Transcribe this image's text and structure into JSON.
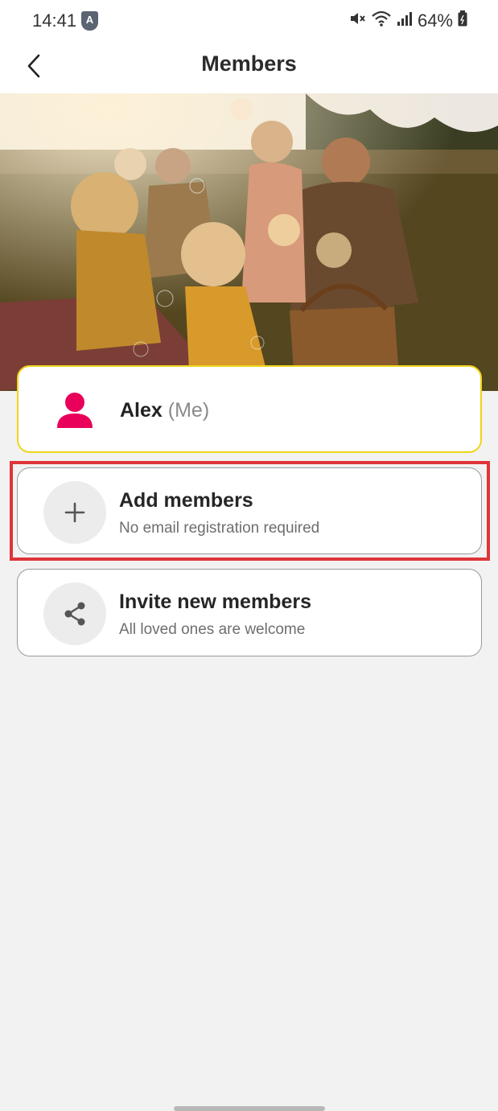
{
  "status_bar": {
    "time": "14:41",
    "badge_letter": "A",
    "battery": "64%"
  },
  "header": {
    "title": "Members"
  },
  "me_card": {
    "name": "Alex",
    "suffix": "(Me)",
    "accent_color": "#e8005a",
    "border_color": "#f0d51a"
  },
  "actions": [
    {
      "title": "Add members",
      "subtitle": "No email registration required",
      "icon": "plus-icon"
    },
    {
      "title": "Invite new members",
      "subtitle": "All loved ones are welcome",
      "icon": "share-icon"
    }
  ],
  "highlight_color": "#e0343a"
}
